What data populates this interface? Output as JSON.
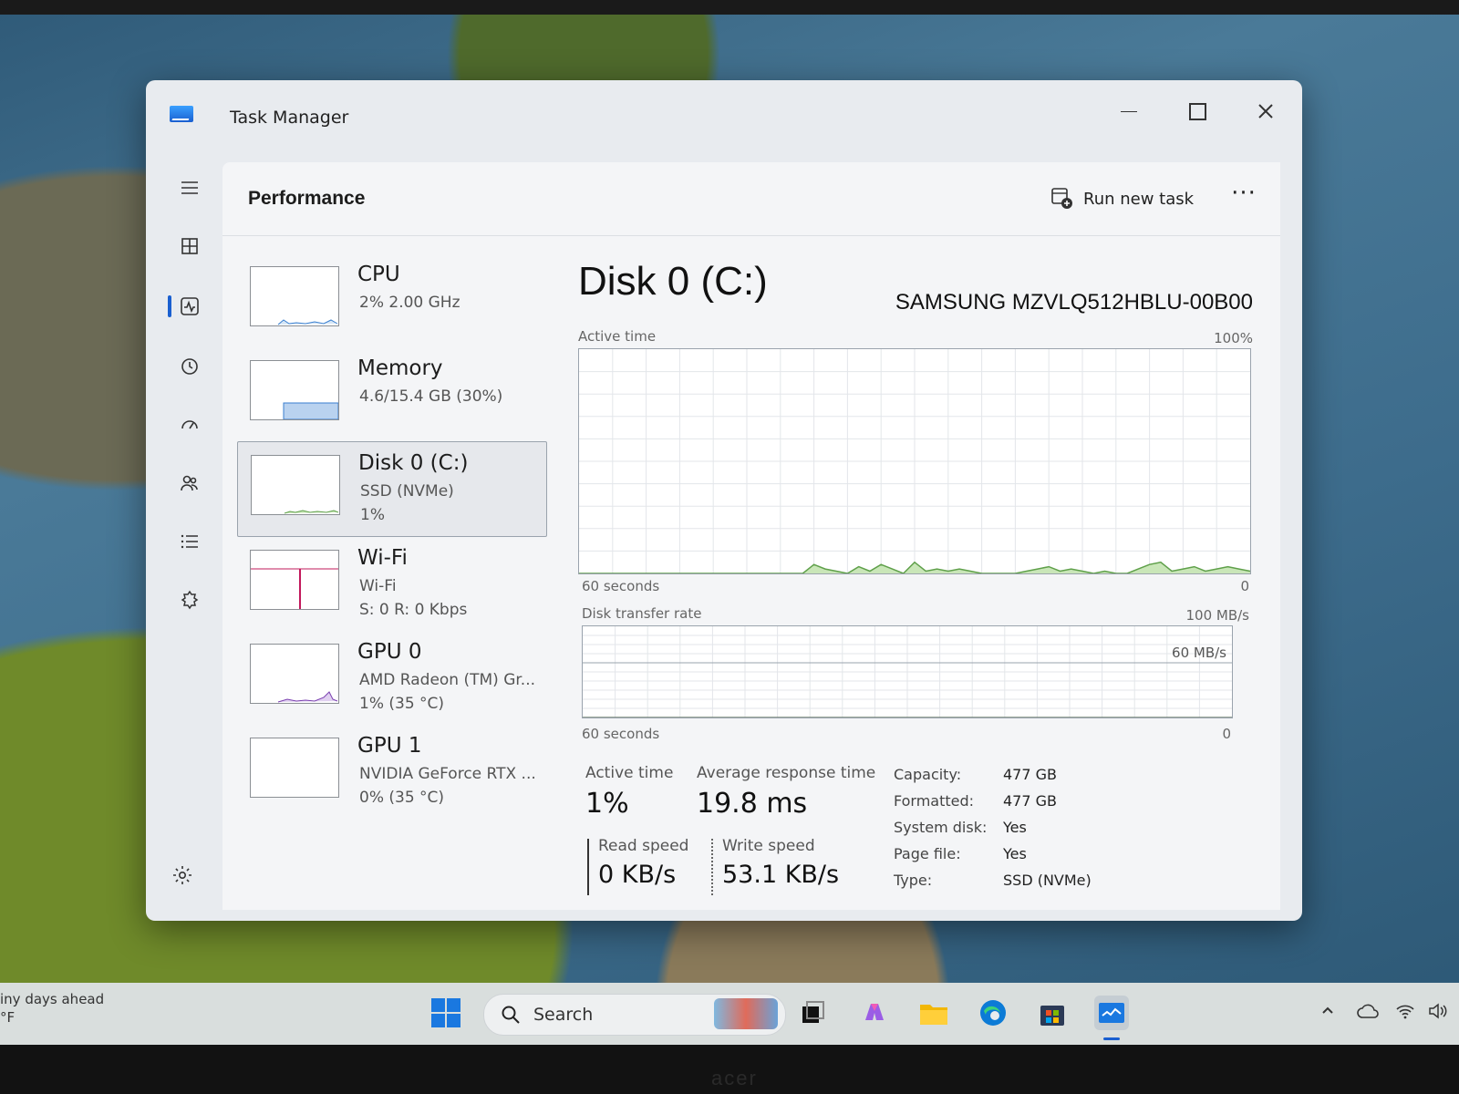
{
  "window": {
    "title": "Task Manager"
  },
  "header": {
    "title": "Performance",
    "run_new_task": "Run new task",
    "more": "···"
  },
  "devices": [
    {
      "name": "CPU",
      "line1": "2%  2.00 GHz",
      "line2": ""
    },
    {
      "name": "Memory",
      "line1": "4.6/15.4 GB (30%)",
      "line2": ""
    },
    {
      "name": "Disk 0 (C:)",
      "line1": "SSD (NVMe)",
      "line2": "1%"
    },
    {
      "name": "Wi-Fi",
      "line1": "Wi-Fi",
      "line2": "S: 0 R: 0 Kbps"
    },
    {
      "name": "GPU 0",
      "line1": "AMD Radeon (TM) Gr...",
      "line2": "1%  (35 °C)"
    },
    {
      "name": "GPU 1",
      "line1": "NVIDIA GeForce RTX ...",
      "line2": "0%  (35 °C)"
    }
  ],
  "detail": {
    "title": "Disk 0 (C:)",
    "model": "SAMSUNG MZVLQ512HBLU-00B00",
    "active_chart": {
      "label": "Active time",
      "max": "100%",
      "x_left": "60 seconds",
      "x_right": "0"
    },
    "transfer_chart": {
      "label": "Disk transfer rate",
      "max": "100 MB/s",
      "mid": "60 MB/s",
      "x_left": "60 seconds",
      "x_right": "0"
    },
    "stats": {
      "active_time_label": "Active time",
      "active_time_value": "1%",
      "avg_response_label": "Average response time",
      "avg_response_value": "19.8 ms",
      "read_speed_label": "Read speed",
      "read_speed_value": "0 KB/s",
      "write_speed_label": "Write speed",
      "write_speed_value": "53.1 KB/s"
    },
    "properties": [
      {
        "key": "Capacity:",
        "value": "477 GB"
      },
      {
        "key": "Formatted:",
        "value": "477 GB"
      },
      {
        "key": "System disk:",
        "value": "Yes"
      },
      {
        "key": "Page file:",
        "value": "Yes"
      },
      {
        "key": "Type:",
        "value": "SSD (NVMe)"
      }
    ]
  },
  "taskbar": {
    "weather_line1": "iny days ahead",
    "weather_line2": "°F",
    "search": "Search"
  },
  "chart_data": {
    "type": "area",
    "title": "Active time",
    "x_range": [
      60,
      0
    ],
    "ylim": [
      0,
      100
    ],
    "values": [
      0,
      0,
      0,
      0,
      0,
      0,
      0,
      0,
      0,
      0,
      0,
      0,
      0,
      0,
      0,
      0,
      0,
      0,
      0,
      0,
      0,
      4,
      2,
      1,
      0,
      3,
      1,
      4,
      2,
      0,
      5,
      1,
      2,
      1,
      2,
      1,
      0,
      0,
      0,
      0,
      1,
      2,
      3,
      1,
      2,
      1,
      0,
      1,
      0,
      0,
      2,
      4,
      5,
      1,
      2,
      3,
      1,
      2,
      3,
      2,
      1
    ],
    "transfer_values": [
      0,
      0,
      0,
      0,
      0,
      0,
      0,
      0,
      0,
      0,
      0,
      0,
      0,
      0,
      0,
      0,
      0,
      0,
      0,
      0,
      0,
      0,
      0,
      0,
      0,
      0,
      0,
      0,
      0,
      0,
      0,
      0,
      0,
      0,
      0,
      0,
      0,
      0,
      0,
      0,
      0,
      0,
      0,
      0,
      0,
      0,
      0,
      0,
      0,
      0,
      0,
      0,
      0,
      0,
      0,
      0,
      0,
      0,
      0,
      0,
      0
    ]
  },
  "colors": {
    "accent": "#1a5fd0",
    "disk_line": "#5fa04a",
    "disk_fill": "#c9e6b8"
  }
}
